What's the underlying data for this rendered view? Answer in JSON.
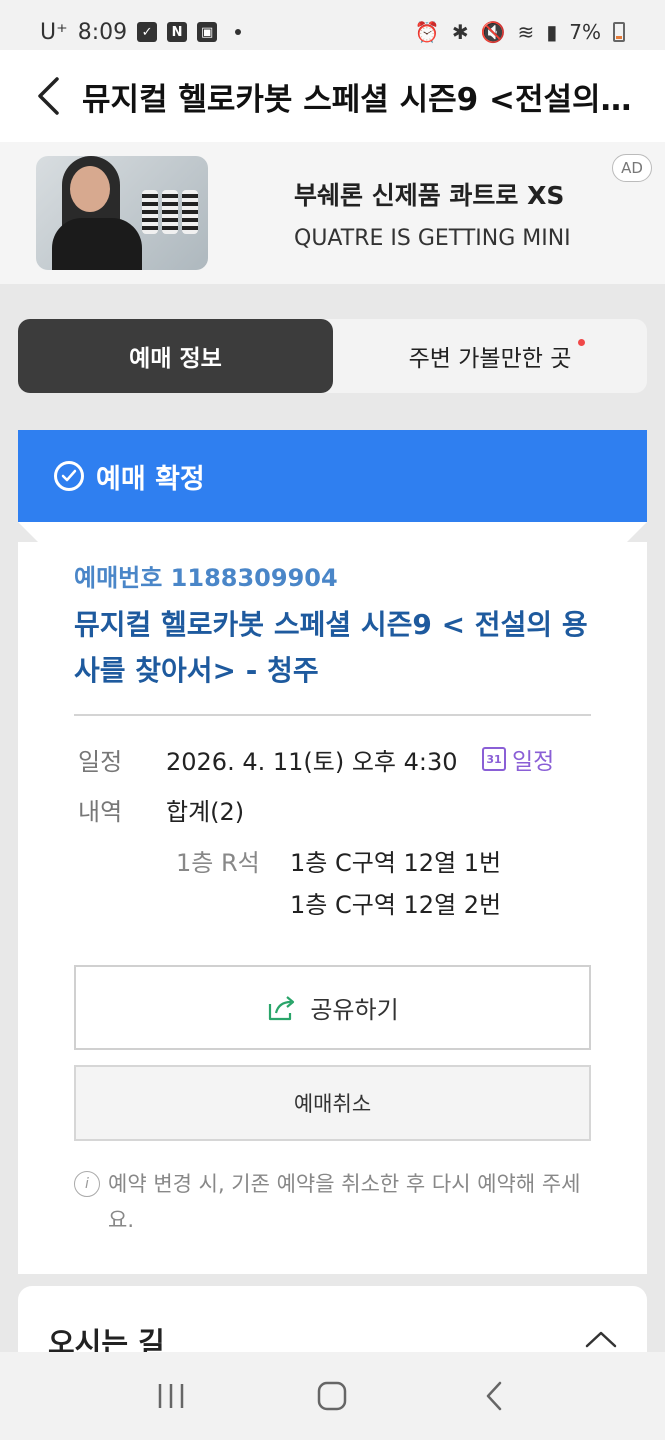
{
  "status_bar": {
    "carrier": "U⁺",
    "time": "8:09",
    "battery": "7%"
  },
  "header": {
    "title": "뮤지컬 헬로카봇 스페셜 시즌9 <전설의…"
  },
  "ad": {
    "title": "부쉐론 신제품 콰트로 XS",
    "subtitle": "QUATRE IS GETTING MINI",
    "badge": "AD"
  },
  "tabs": [
    {
      "label": "예매 정보",
      "active": true
    },
    {
      "label": "주변 가볼만한 곳",
      "active": false
    }
  ],
  "confirmation": {
    "label": "예매 확정",
    "color": "#2f7ff0"
  },
  "booking": {
    "number_label": "예매번호 1188309904",
    "title": "뮤지컬 헬로카봇 스페셜 시즌9 < 전설의 용사를 찾아서> - 청주",
    "schedule_label": "일정",
    "schedule_value": "2026. 4. 11(토) 오후 4:30",
    "calendar_link": "일정",
    "calendar_icon_text": "31",
    "details_label": "내역",
    "details_value": "합계(2)",
    "seat_type": "1층 R석",
    "seats": [
      "1층 C구역 12열 1번",
      "1층 C구역 12열 2번"
    ]
  },
  "actions": {
    "share": "공유하기",
    "cancel": "예매취소"
  },
  "notice": "예약 변경 시, 기존 예약을 취소한 후 다시 예약해 주세요.",
  "directions": {
    "title": "오시는 길"
  }
}
